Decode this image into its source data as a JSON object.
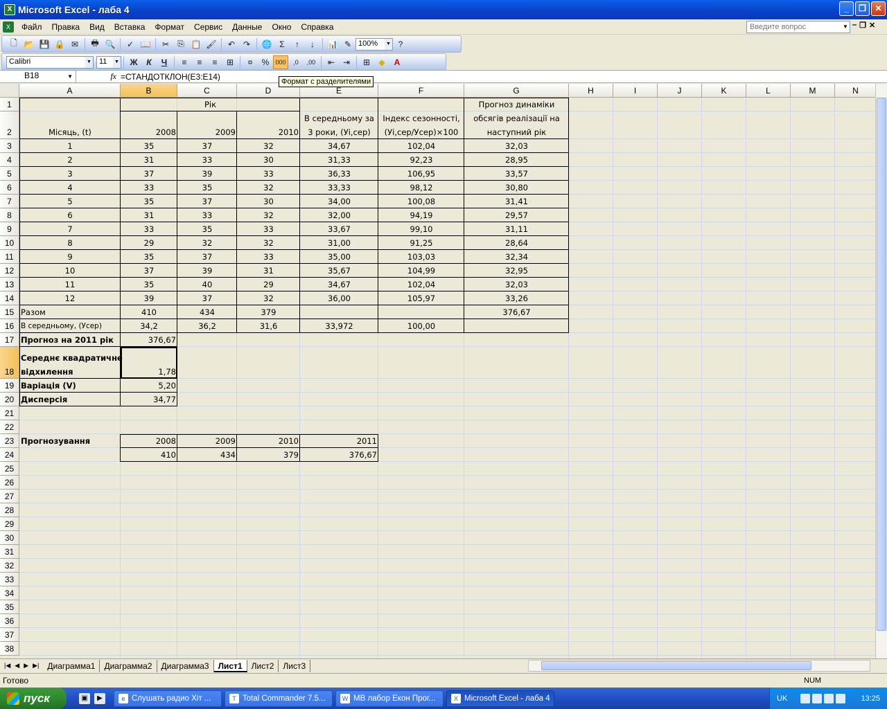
{
  "window": {
    "title": "Microsoft Excel - лаба 4",
    "minimize": "_",
    "maximize": "❐",
    "close": "✕"
  },
  "menu": {
    "items": [
      "Файл",
      "Правка",
      "Вид",
      "Вставка",
      "Формат",
      "Сервис",
      "Данные",
      "Окно",
      "Справка"
    ],
    "help_placeholder": "Введите вопрос"
  },
  "toolbar": {
    "zoom": "100%",
    "font": "Calibri",
    "font_size": "11",
    "bold": "Ж",
    "italic": "К",
    "underline": "Ч",
    "percent": "%",
    "thousands": "000",
    "sum": "Σ"
  },
  "tooltip": "Формат с разделителями",
  "formula_bar": {
    "name_box": "B18",
    "fx": "fx",
    "formula": "=СТАНДОТКЛОН(E3:E14)"
  },
  "columns": [
    "A",
    "B",
    "C",
    "D",
    "E",
    "F",
    "G",
    "H",
    "I",
    "J",
    "K",
    "L",
    "M",
    "N"
  ],
  "rows": [
    "1",
    "2",
    "3",
    "4",
    "5",
    "6",
    "7",
    "8",
    "9",
    "10",
    "11",
    "12",
    "13",
    "14",
    "15",
    "16",
    "17",
    "18",
    "19",
    "20",
    "21",
    "22",
    "23",
    "24",
    "25",
    "26",
    "27",
    "28",
    "29",
    "30",
    "31",
    "32",
    "33",
    "34",
    "35",
    "36",
    "37",
    "38"
  ],
  "sheet": {
    "header_year": "Рік",
    "header_month": "Місяць, (t)",
    "header_avg": [
      "В середньому за",
      "3 роки, (Уі,сер)"
    ],
    "header_index": [
      "Індекс сезонності,",
      "(Уі,сер/Усер)×100"
    ],
    "header_forecast": [
      "Прогноз динаміки",
      "обсягів реалізації на",
      "наступний рік"
    ],
    "years": [
      "2008",
      "2009",
      "2010"
    ],
    "data_rows": [
      [
        "1",
        "35",
        "37",
        "32",
        "34,67",
        "102,04",
        "32,03"
      ],
      [
        "2",
        "31",
        "33",
        "30",
        "31,33",
        "92,23",
        "28,95"
      ],
      [
        "3",
        "37",
        "39",
        "33",
        "36,33",
        "106,95",
        "33,57"
      ],
      [
        "4",
        "33",
        "35",
        "32",
        "33,33",
        "98,12",
        "30,80"
      ],
      [
        "5",
        "35",
        "37",
        "30",
        "34,00",
        "100,08",
        "31,41"
      ],
      [
        "6",
        "31",
        "33",
        "32",
        "32,00",
        "94,19",
        "29,57"
      ],
      [
        "7",
        "33",
        "35",
        "33",
        "33,67",
        "99,10",
        "31,11"
      ],
      [
        "8",
        "29",
        "32",
        "32",
        "31,00",
        "91,25",
        "28,64"
      ],
      [
        "9",
        "35",
        "37",
        "33",
        "35,00",
        "103,03",
        "32,34"
      ],
      [
        "10",
        "37",
        "39",
        "31",
        "35,67",
        "104,99",
        "32,95"
      ],
      [
        "11",
        "35",
        "40",
        "29",
        "34,67",
        "102,04",
        "32,03"
      ],
      [
        "12",
        "39",
        "37",
        "32",
        "36,00",
        "105,97",
        "33,26"
      ]
    ],
    "total": {
      "label": "Разом",
      "b": "410",
      "c": "434",
      "d": "379",
      "g": "376,67"
    },
    "average": {
      "label": "В середньому, (Усер)",
      "b": "34,2",
      "c": "36,2",
      "d": "31,6",
      "e": "33,972",
      "f": "100,00"
    },
    "forecast2011": {
      "label": "Прогноз на 2011 рік",
      "value": "376,67"
    },
    "stdev": {
      "label1": "Середнє квадратичне",
      "label2": "відхилення",
      "value": "1,78"
    },
    "variation": {
      "label": "Варіація (V)",
      "value": "5,20"
    },
    "dispersion": {
      "label": "Дисперсія",
      "value": "34,77"
    },
    "forecasting": {
      "label": "Прогнозування",
      "years": [
        "2008",
        "2009",
        "2010",
        "2011"
      ],
      "values": [
        "410",
        "434",
        "379",
        "376,67"
      ]
    }
  },
  "sheet_tabs": [
    "Диаграмма1",
    "Диаграмма2",
    "Диаграмма3",
    "Лист1",
    "Лист2",
    "Лист3"
  ],
  "active_tab": "Лист1",
  "status": {
    "ready": "Готово",
    "num": "NUM"
  },
  "taskbar": {
    "start": "пуск",
    "tasks": [
      "Слушать радио Хіт ...",
      "Total Commander 7.5...",
      "МВ лабор Екон Прог...",
      "Microsoft Excel - лаба 4"
    ],
    "lang": "UK",
    "clock": "13:25"
  }
}
